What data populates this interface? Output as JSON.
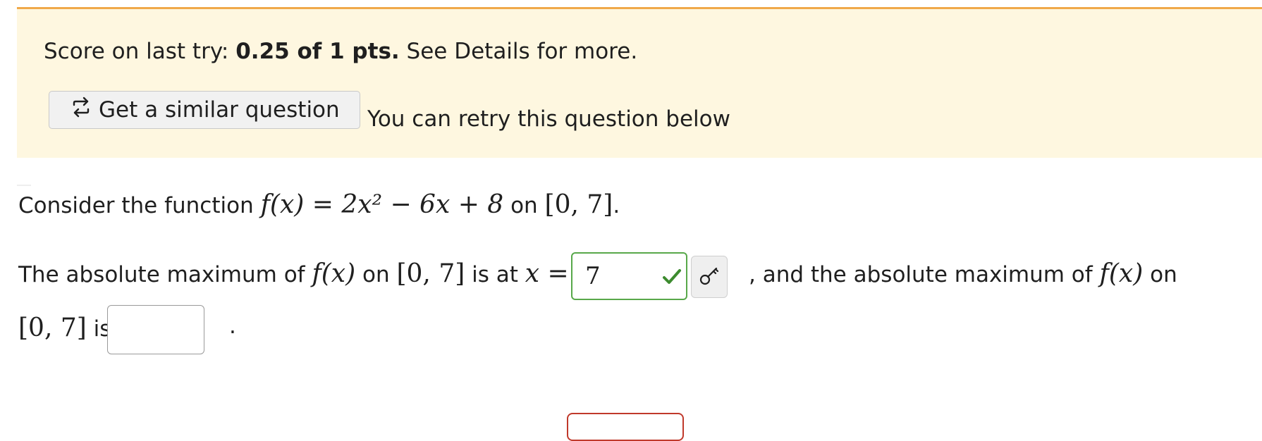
{
  "banner": {
    "score_prefix": "Score on last try: ",
    "score_value": "0.25 of 1 pts.",
    "score_suffix": " See Details for more.",
    "similar_button_label": "Get a similar question",
    "similar_button_icon": "repeat-icon",
    "retry_text": "You can retry this question below",
    "background_color": "#fef7e0",
    "accent_color": "#f0a94a"
  },
  "question": {
    "line1": {
      "prefix": "Consider the function ",
      "func": "f(x) = 2x² − 6x + 8",
      "on": " on ",
      "interval": "[0, 7]",
      "end": "."
    },
    "line2": {
      "prefix": "The absolute maximum of ",
      "fx": "f(x)",
      "on": " on ",
      "interval": "[0, 7]",
      "is_at": " is at ",
      "x_eq": "x =",
      "and_text": ", and the absolute maximum of ",
      "fx2": "f(x)",
      "on2": " on"
    },
    "line3": {
      "interval": "[0, 7]",
      "is": " is",
      "period": "."
    },
    "answer1": {
      "value": "7",
      "status": "correct",
      "status_color": "#3d8b2f",
      "status_icon": "check-icon"
    },
    "key_button_icon": "key-icon",
    "answer2": {
      "value": ""
    }
  }
}
